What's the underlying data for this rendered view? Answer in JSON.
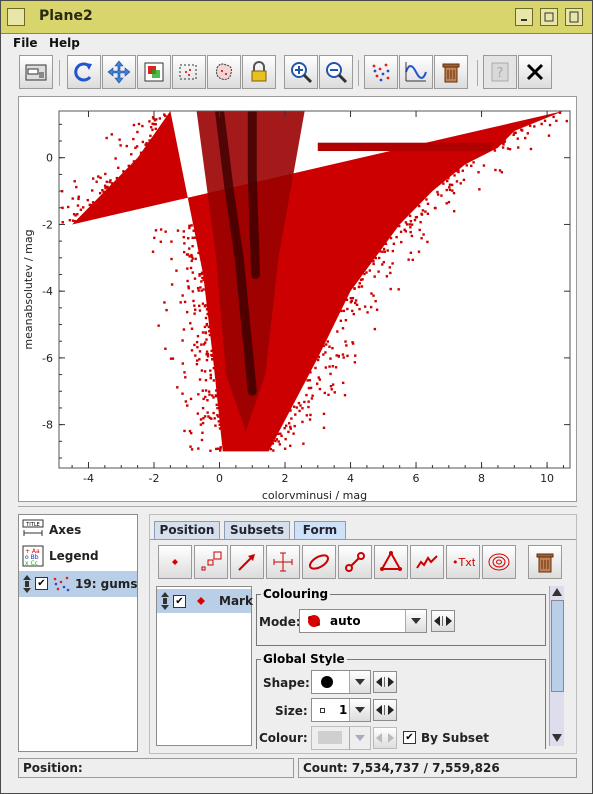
{
  "window": {
    "title": "Plane2"
  },
  "menu": {
    "file": "File",
    "help": "Help"
  },
  "plot": {
    "xlabel": "colorvminusi / mag",
    "ylabel": "meanabsolutev / mag",
    "xticks": [
      "-4",
      "-2",
      "0",
      "2",
      "4",
      "6",
      "8",
      "10"
    ],
    "yticks": [
      "0",
      "-2",
      "-4",
      "-6",
      "-8"
    ]
  },
  "chart_data": {
    "type": "scatter",
    "xlabel": "colorvminusi / mag",
    "ylabel": "meanabsolutev / mag",
    "xlim": [
      -4.9,
      10.7
    ],
    "ylim": [
      -9.3,
      1.4
    ],
    "grid": false,
    "point_color": "#cc0000",
    "density_color": "#3a0000",
    "density_ridges": [
      {
        "x": [
          0.0,
          0.3,
          0.6,
          0.8,
          1.0
        ],
        "y": [
          1.4,
          -1.0,
          -3.0,
          -5.0,
          -7.0
        ]
      },
      {
        "x": [
          1.0,
          1.0,
          1.05,
          1.1
        ],
        "y": [
          1.4,
          -0.5,
          -2.0,
          -3.5
        ]
      }
    ],
    "envelope_left": {
      "x": [
        -4.5,
        -3.5,
        -2.5,
        -1.5,
        -0.5,
        -0.2,
        0.1
      ],
      "y": [
        -2.0,
        -1.0,
        0.0,
        1.4,
        -3.5,
        -6.0,
        -8.8
      ]
    },
    "envelope_right": {
      "x": [
        1.5,
        3.0,
        4.0,
        5.5,
        6.5,
        7.5,
        8.5,
        9.0,
        10.5
      ],
      "y": [
        -8.8,
        -6.0,
        -4.0,
        -2.0,
        -1.0,
        -0.2,
        0.3,
        0.8,
        1.4
      ]
    }
  },
  "layers_panel": {
    "axes": "Axes",
    "legend": "Legend",
    "layer": "19: gums"
  },
  "tabs": {
    "position": "Position",
    "subsets": "Subsets",
    "form": "Form"
  },
  "form": {
    "layer_label": "Mark",
    "colouring_title": "Colouring",
    "mode_label": "Mode:",
    "mode_value": "auto",
    "global_style_title": "Global Style",
    "shape_label": "Shape:",
    "size_label": "Size:",
    "size_value": "1",
    "colour_label": "Colour:",
    "by_subset": "By Subset"
  },
  "status": {
    "position_label": "Position:",
    "count_text": "Count: 7,534,737 / 7,559,826"
  }
}
